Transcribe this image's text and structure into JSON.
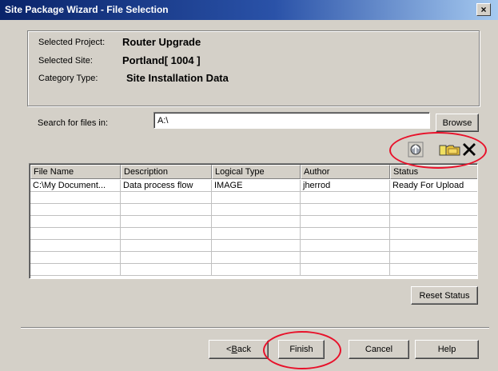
{
  "window": {
    "title": "Site Package Wizard - File Selection",
    "close_label": "×"
  },
  "info": {
    "project_label": "Selected Project:",
    "project_value": "Router Upgrade",
    "site_label": "Selected Site:",
    "site_value": "Portland[ 1004 ]",
    "category_label": "Category Type:",
    "category_value": "Site Installation Data"
  },
  "search": {
    "label": "Search for files in:",
    "value": "A:\\",
    "browse_label": "Browse"
  },
  "toolbar": {
    "icons": [
      "upload-icon",
      "folder-icon",
      "delete-icon"
    ]
  },
  "table": {
    "columns": [
      "File Name",
      "Description",
      "Logical Type",
      "Author",
      "Status"
    ],
    "rows": [
      [
        "C:\\My Document...",
        "Data process flow",
        "IMAGE",
        "jherrod",
        "Ready For Upload"
      ]
    ]
  },
  "buttons": {
    "reset_label": "Reset Status",
    "back_mnemonic": "B",
    "back_rest": "ack",
    "back_prefix": "< ",
    "finish_label": "Finish",
    "cancel_label": "Cancel",
    "help_label": "Help"
  },
  "colors": {
    "title_bar": "#0a246a",
    "dialog_bg": "#d4d0c8",
    "annotation": "#e8112a"
  }
}
